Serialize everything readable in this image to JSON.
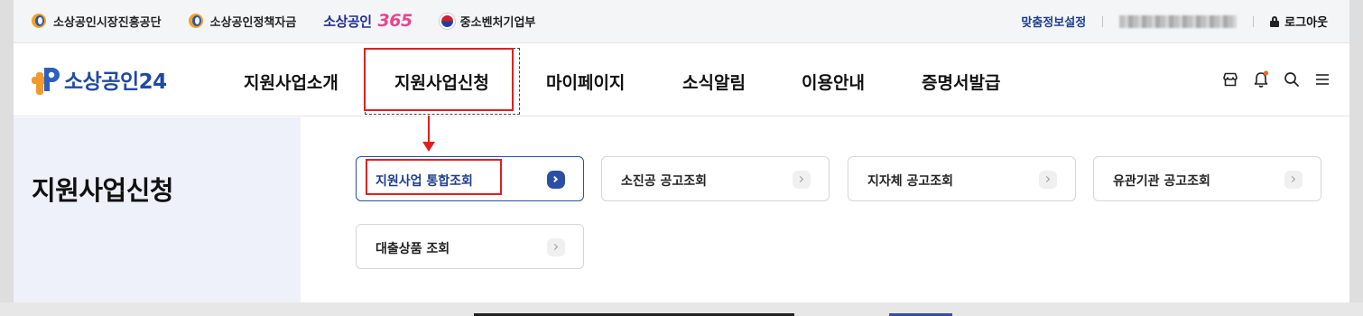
{
  "topbar": {
    "links": [
      {
        "label": "소상공인시장진흥공단",
        "icon": "semas-logo-icon"
      },
      {
        "label": "소상공인정책자금",
        "icon": "semas-logo-icon"
      }
    ],
    "brand365": {
      "prefix": "소상공인",
      "suffix": "365"
    },
    "ministry": {
      "label": "중소벤처기업부",
      "icon": "taeguk-icon"
    },
    "custom_info": "맞춤정보설정",
    "logout": "로그아웃"
  },
  "header": {
    "logo_text": "소상공인24",
    "nav": [
      "지원사업소개",
      "지원사업신청",
      "마이페이지",
      "소식알림",
      "이용안내",
      "증명서발급"
    ],
    "active_nav_index": 1,
    "icons": [
      "store-icon",
      "bell-icon",
      "search-icon",
      "menu-icon"
    ]
  },
  "side": {
    "title": "지원사업신청"
  },
  "cards": [
    {
      "label": "지원사업 통합조회",
      "active": true
    },
    {
      "label": "소진공 공고조회",
      "active": false
    },
    {
      "label": "지자체 공고조회",
      "active": false
    },
    {
      "label": "유관기관 공고조회",
      "active": false
    },
    {
      "label": "대출상품 조회",
      "active": false
    }
  ],
  "colors": {
    "accent": "#1f4aa3",
    "annotation": "#e02020",
    "side_bg": "#eef1fa",
    "notify_dot": "#f26b1d"
  }
}
